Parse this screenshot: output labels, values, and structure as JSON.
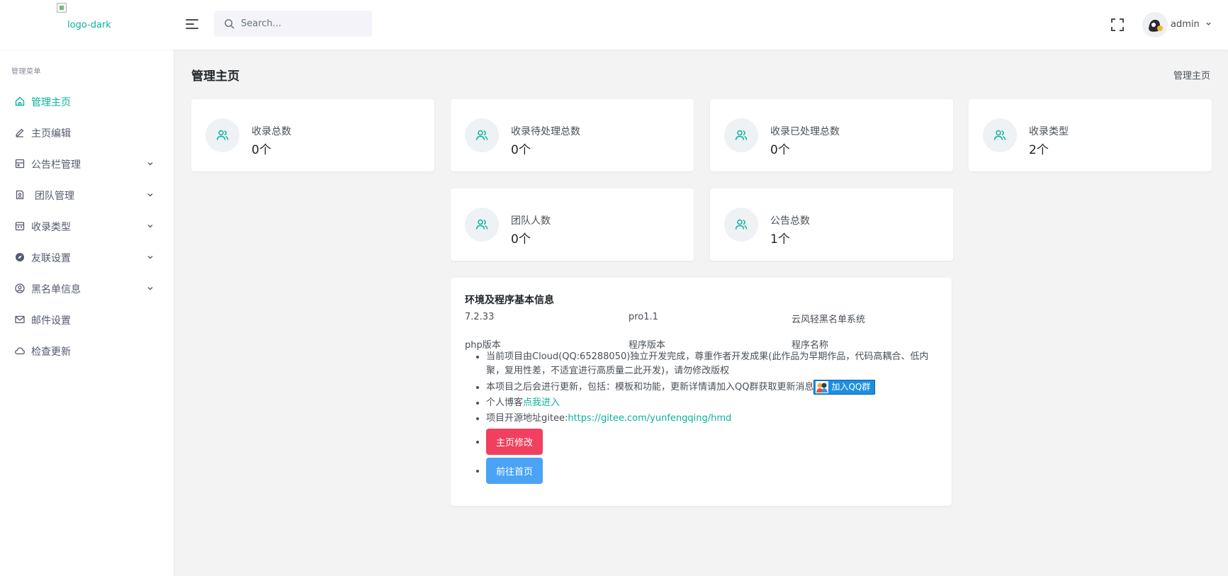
{
  "header": {
    "logo_alt": "logo-dark",
    "search_placeholder": "Search...",
    "username": "admin"
  },
  "sidebar": {
    "menu_title": "管理菜单",
    "items": [
      {
        "label": "管理主页",
        "icon": "home-icon",
        "active": true,
        "has_caret": false
      },
      {
        "label": "主页编辑",
        "icon": "pencil-icon",
        "active": false,
        "has_caret": false
      },
      {
        "label": "公告栏管理",
        "icon": "layout-icon",
        "active": false,
        "has_caret": true
      },
      {
        "label": "团队管理",
        "icon": "contact-icon",
        "active": false,
        "has_caret": true
      },
      {
        "label": "收录类型",
        "icon": "calendar-icon",
        "active": false,
        "has_caret": true
      },
      {
        "label": "友联设置",
        "icon": "compass-icon",
        "active": false,
        "has_caret": true
      },
      {
        "label": "黑名单信息",
        "icon": "user-circle-icon",
        "active": false,
        "has_caret": true
      },
      {
        "label": "邮件设置",
        "icon": "mail-icon",
        "active": false,
        "has_caret": false
      },
      {
        "label": "检查更新",
        "icon": "cloud-icon",
        "active": false,
        "has_caret": false
      }
    ]
  },
  "main": {
    "page_title": "管理主页",
    "breadcrumb": "管理主页",
    "stats": [
      {
        "label": "收录总数",
        "value": "0个"
      },
      {
        "label": "收录待处理总数",
        "value": "0个"
      },
      {
        "label": "收录已处理总数",
        "value": "0个"
      },
      {
        "label": "收录类型",
        "value": "2个"
      },
      {
        "label": "团队人数",
        "value": "0个"
      },
      {
        "label": "公告总数",
        "value": "1个"
      }
    ],
    "info": {
      "title": "环境及程序基本信息",
      "php_version": "7.2.33",
      "program_version": "pro1.1",
      "program_name": "云风轻黑名单系统",
      "php_version_label": "php版本",
      "program_version_label": "程序版本",
      "program_name_label": "程序名称",
      "note1": "当前项目由Cloud(QQ:65288050)独立开发完成，尊重作者开发成果(此作品为早期作品，代码高耦合、低内聚，复用性差，不适宜进行高质量二此开发)，请勿修改版权",
      "note2": "本项目之后会进行更新，包括：模板和功能，更新详情请加入QQ群获取更新消息",
      "qq_group_label": "加入QQ群",
      "blog_prefix": "个人博客",
      "blog_link": "点我进入",
      "repo_prefix": "项目开源地址gitee:",
      "repo_link": "https://gitee.com/yunfengqing/hmd",
      "edit_button": "主页修改",
      "home_button": "前往首页"
    }
  },
  "colors": {
    "accent": "#0ab39c",
    "danger": "#f0405f",
    "primary": "#4aa3f5",
    "background": "#f3f3f4"
  }
}
